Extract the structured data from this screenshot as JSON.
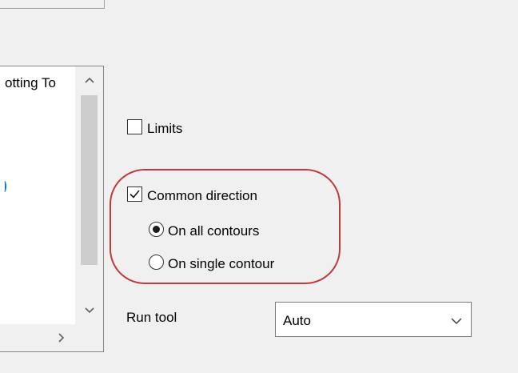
{
  "list": {
    "item_text": "otting To"
  },
  "options": {
    "limits_label": "Limits",
    "limits_checked": false,
    "common_direction_label": "Common direction",
    "common_direction_checked": true,
    "radio_all_label": "On all contours",
    "radio_single_label": "On single contour",
    "selected_radio": "On all contours"
  },
  "run_tool": {
    "label": "Run tool",
    "value": "Auto"
  },
  "colors": {
    "highlight": "#c0393b",
    "selection_mark": "#0078d7"
  }
}
